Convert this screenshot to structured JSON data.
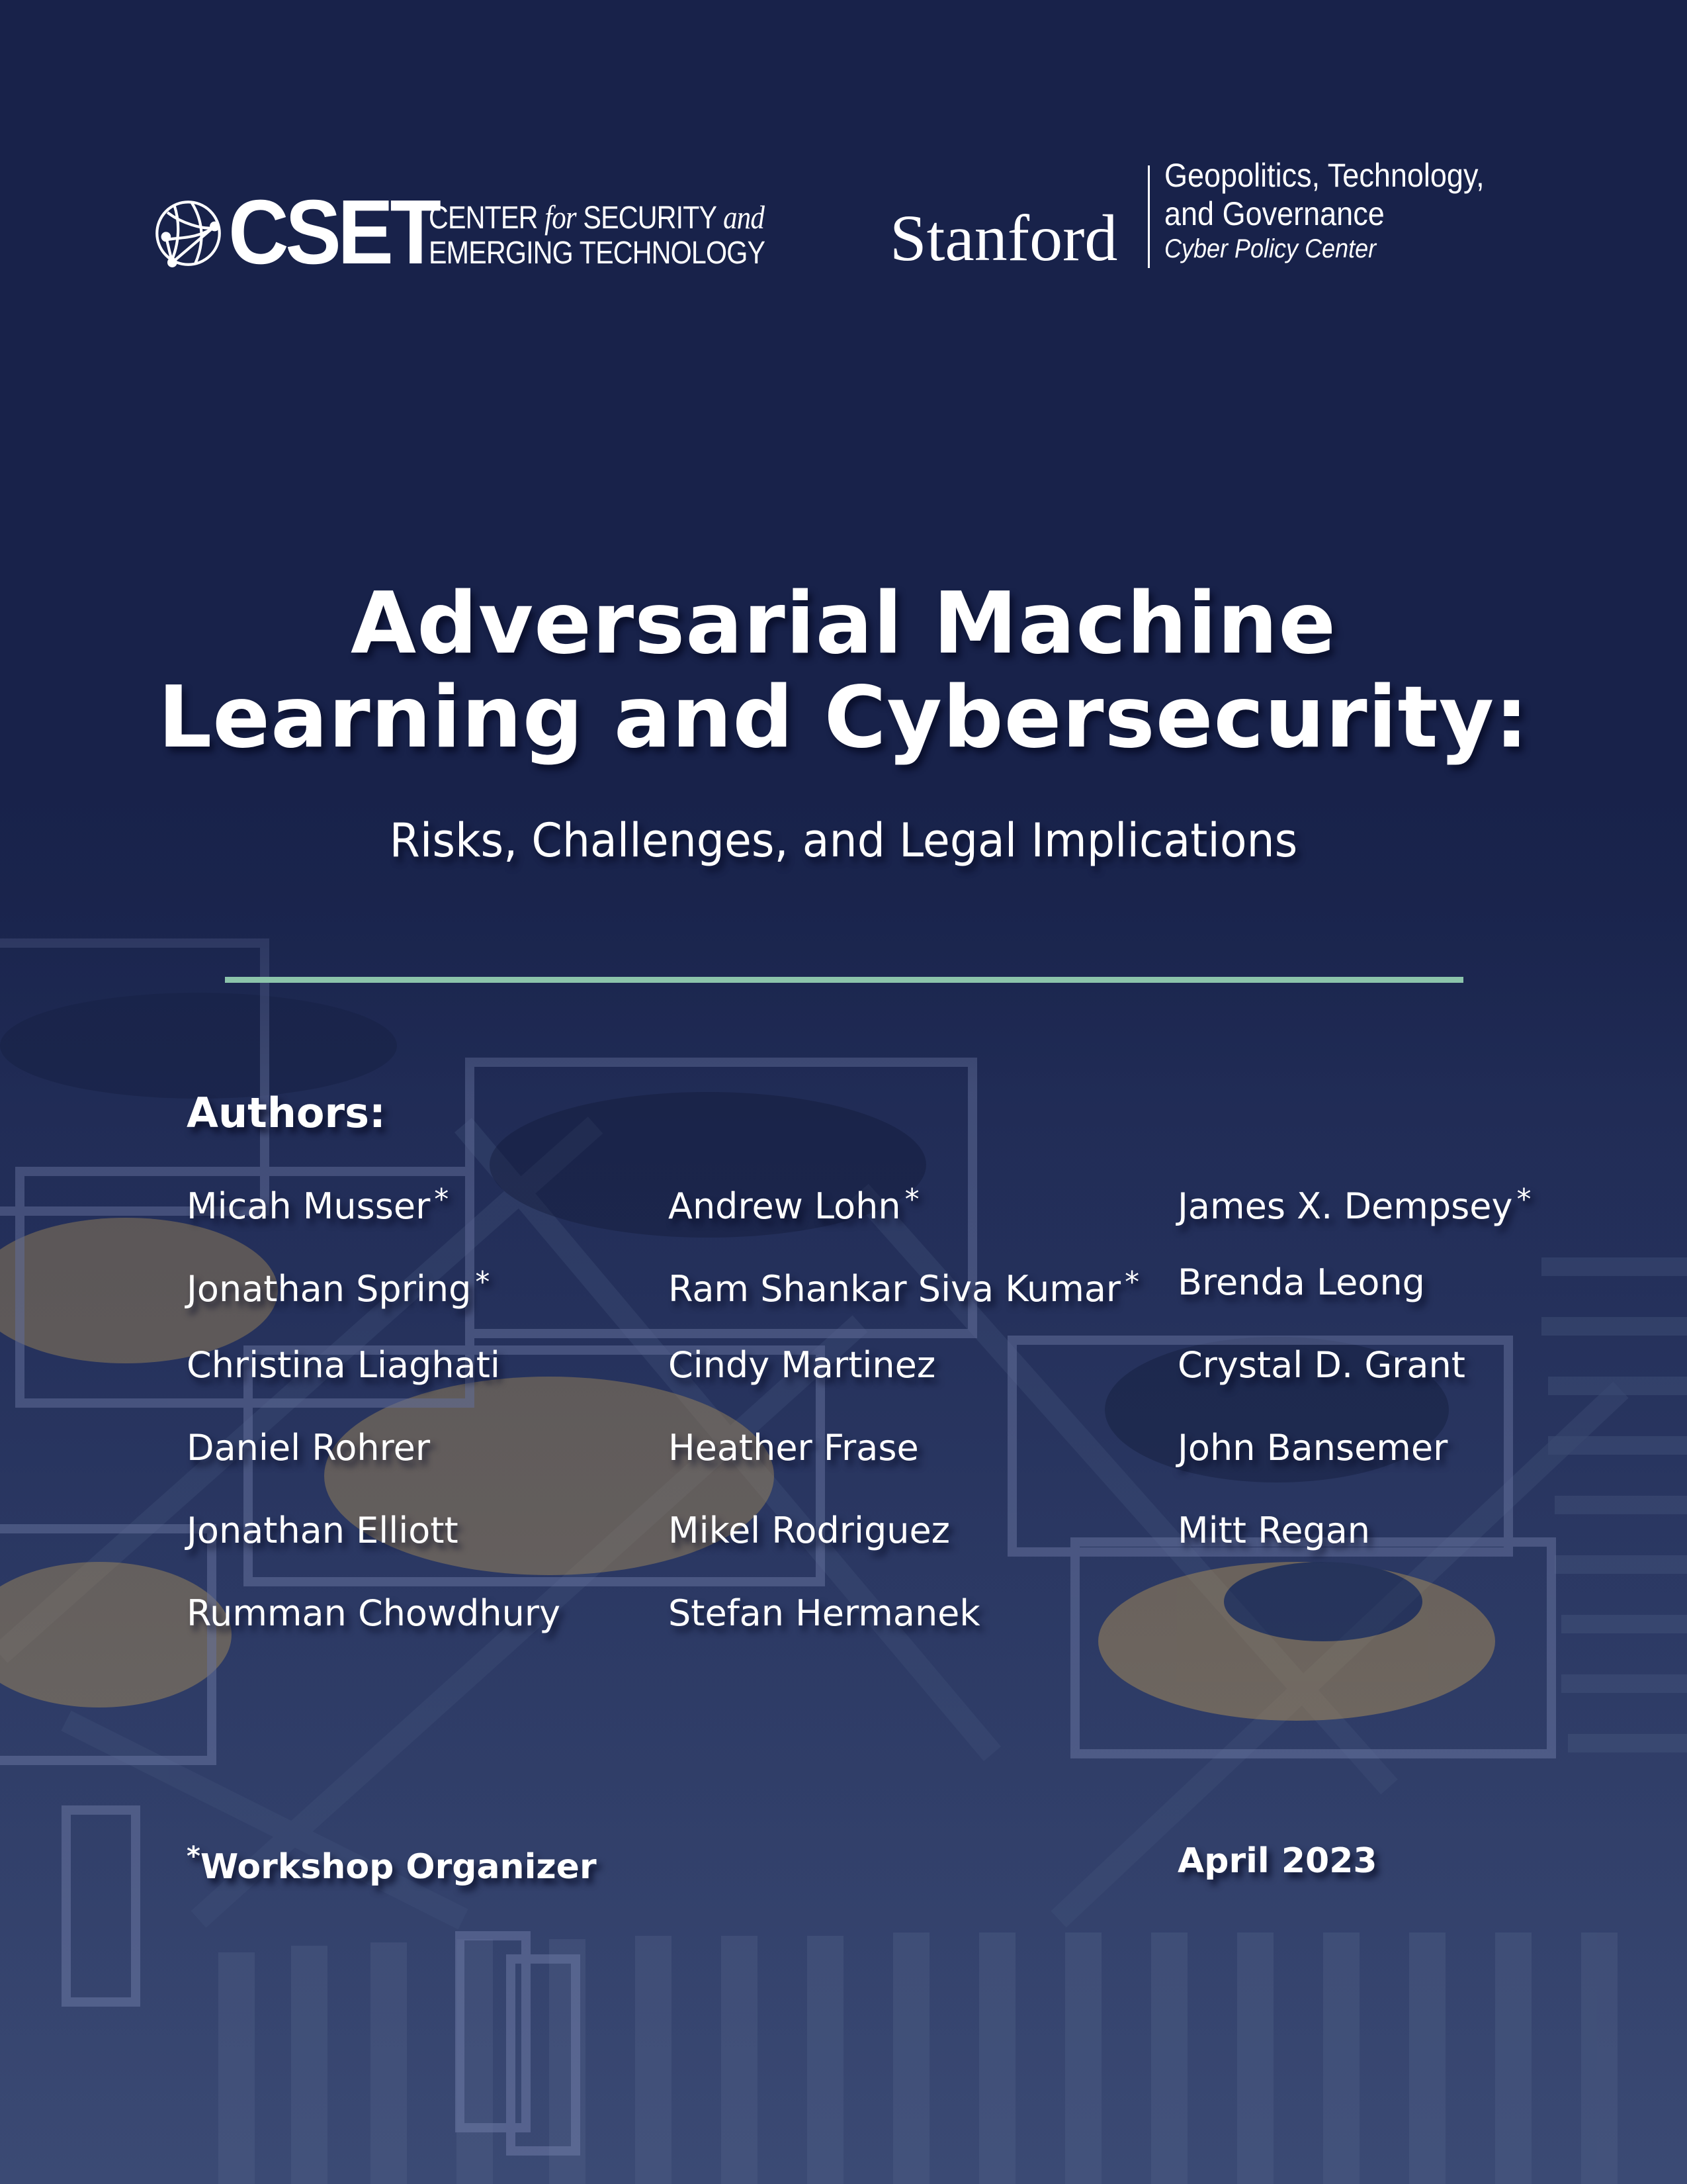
{
  "header": {
    "cset": {
      "acronym": "CSET",
      "line1_a": "CENTER",
      "line1_b": "for",
      "line1_c": "SECURITY",
      "line1_d": "and",
      "line2": "EMERGING TECHNOLOGY"
    },
    "stanford": {
      "name": "Stanford",
      "program_line1": "Geopolitics, Technology,",
      "program_line2": "and Governance",
      "center": "Cyber Policy Center"
    }
  },
  "title": {
    "line1": "Adversarial Machine",
    "line2": "Learning and Cybersecurity:",
    "subtitle": "Risks, Challenges, and Legal Implications"
  },
  "colors": {
    "background": "#1a2447",
    "rule": "#8cc4ab",
    "text": "#ffffff"
  },
  "authors": {
    "label": "Authors:",
    "organizer_marker": "*",
    "columns": [
      [
        {
          "name": "Micah Musser",
          "organizer": "*"
        },
        {
          "name": "Jonathan Spring",
          "organizer": "*"
        },
        {
          "name": "Christina Liaghati",
          "organizer": ""
        },
        {
          "name": "Daniel Rohrer",
          "organizer": ""
        },
        {
          "name": "Jonathan Elliott",
          "organizer": ""
        },
        {
          "name": "Rumman Chowdhury",
          "organizer": ""
        }
      ],
      [
        {
          "name": "Andrew Lohn",
          "organizer": "*"
        },
        {
          "name": "Ram Shankar Siva Kumar",
          "organizer": "*"
        },
        {
          "name": "Cindy Martinez",
          "organizer": ""
        },
        {
          "name": "Heather Frase",
          "organizer": ""
        },
        {
          "name": "Mikel Rodriguez",
          "organizer": ""
        },
        {
          "name": "Stefan Hermanek",
          "organizer": ""
        }
      ],
      [
        {
          "name": "James X. Dempsey",
          "organizer": "*"
        },
        {
          "name": "Brenda Leong",
          "organizer": ""
        },
        {
          "name": "Crystal D. Grant",
          "organizer": ""
        },
        {
          "name": "John Bansemer",
          "organizer": ""
        },
        {
          "name": "Mitt Regan",
          "organizer": ""
        }
      ]
    ]
  },
  "footer": {
    "note_marker": "*",
    "note": "Workshop Organizer",
    "date": "April 2023"
  }
}
